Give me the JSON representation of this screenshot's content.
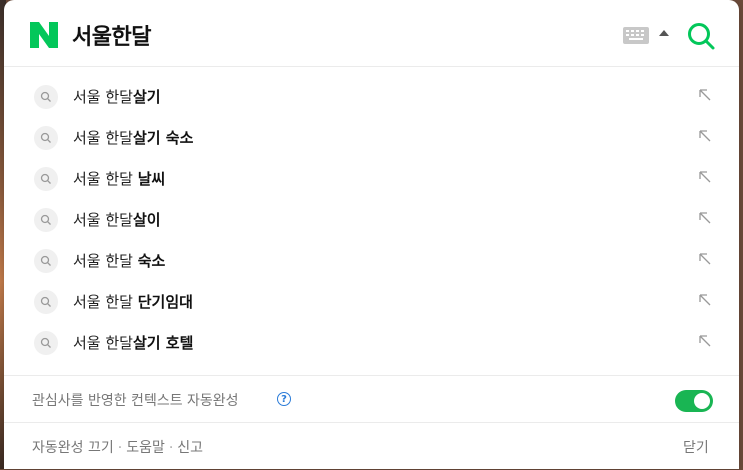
{
  "search": {
    "query": "서울한달"
  },
  "icons": {
    "logo": "naver-n-logo",
    "keyboard": "keyboard-icon",
    "collapse": "caret-up-icon",
    "search": "search-icon",
    "suggestion": "magnifier-icon",
    "fill": "arrow-up-left-icon",
    "help": "question-circle-icon"
  },
  "colors": {
    "brand": "#03c75a",
    "toggle_on": "#19b553",
    "help": "#2a7bd8"
  },
  "suggestions": [
    {
      "prefix": "서울 한달",
      "bold": "살기"
    },
    {
      "prefix": "서울 한달",
      "bold": "살기 숙소"
    },
    {
      "prefix": "서울 한달 ",
      "bold": "날씨"
    },
    {
      "prefix": "서울 한달",
      "bold": "살이"
    },
    {
      "prefix": "서울 한달 ",
      "bold": "숙소"
    },
    {
      "prefix": "서울 한달 ",
      "bold": "단기임대"
    },
    {
      "prefix": "서울 한달",
      "bold": "살기 호텔"
    }
  ],
  "context": {
    "label": "관심사를 반영한 컨텍스트 자동완성",
    "help_glyph": "?",
    "enabled": true
  },
  "footer": {
    "link_off": "자동완성 끄기",
    "link_help": "도움말",
    "link_report": "신고",
    "separator": "·",
    "close": "닫기"
  }
}
